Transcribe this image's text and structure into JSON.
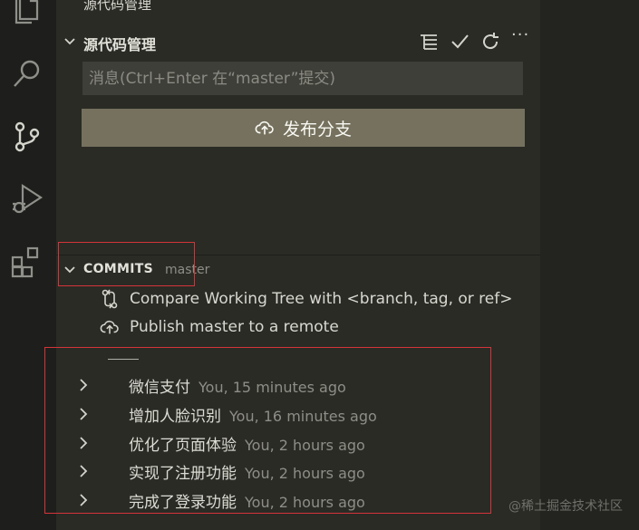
{
  "activity_bar": {
    "icons": [
      "files-icon",
      "search-icon",
      "source-control-icon",
      "run-debug-icon",
      "extensions-icon"
    ]
  },
  "top_header": {
    "title": "源代码管理",
    "more": "···"
  },
  "scm": {
    "title": "源代码管理",
    "toolbar": [
      "view-as-tree-icon",
      "commit-check-icon",
      "refresh-icon",
      "more-actions-icon"
    ],
    "more": "···",
    "message_placeholder": "消息(Ctrl+Enter 在“master”提交)",
    "publish_label": "发布分支"
  },
  "commits": {
    "title": "COMMITS",
    "branch": "master",
    "actions": [
      {
        "label": "Compare Working Tree with <branch, tag, or ref>",
        "icon": "compare-icon"
      },
      {
        "label": "Publish master to a remote",
        "icon": "cloud-upload-icon"
      }
    ],
    "items": [
      {
        "message": "微信支付",
        "meta": "You, 15 minutes ago"
      },
      {
        "message": "增加人脸识别",
        "meta": "You, 16 minutes ago"
      },
      {
        "message": "优化了页面体验",
        "meta": "You, 2 hours ago"
      },
      {
        "message": "实现了注册功能",
        "meta": "You, 2 hours ago"
      },
      {
        "message": "完成了登录功能",
        "meta": "You, 2 hours ago"
      }
    ]
  },
  "watermark": "@稀土掘金技术社区",
  "colors": {
    "background": "#272822",
    "button": "#75715e",
    "highlight": "#d4343a"
  }
}
